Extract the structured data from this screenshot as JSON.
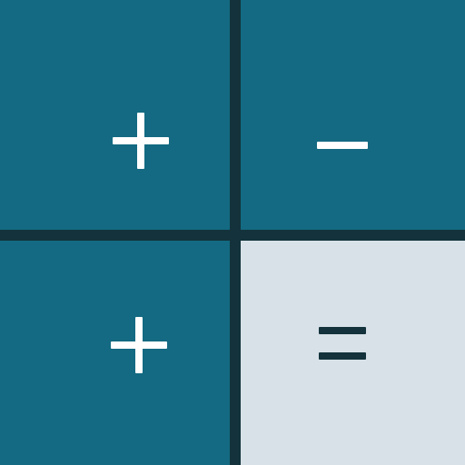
{
  "keypad": {
    "keys": [
      {
        "id": "plus-top",
        "icon": "plus-icon",
        "tile_color": "#136a82",
        "icon_color": "#ffffff"
      },
      {
        "id": "minus",
        "icon": "minus-icon",
        "tile_color": "#136a82",
        "icon_color": "#ffffff"
      },
      {
        "id": "plus-bottom",
        "icon": "plus-icon",
        "tile_color": "#136a82",
        "icon_color": "#ffffff"
      },
      {
        "id": "equals",
        "icon": "equals-icon",
        "tile_color": "#d7e1e7",
        "icon_color": "#13323b"
      }
    ],
    "divider_color": "#13323b"
  }
}
